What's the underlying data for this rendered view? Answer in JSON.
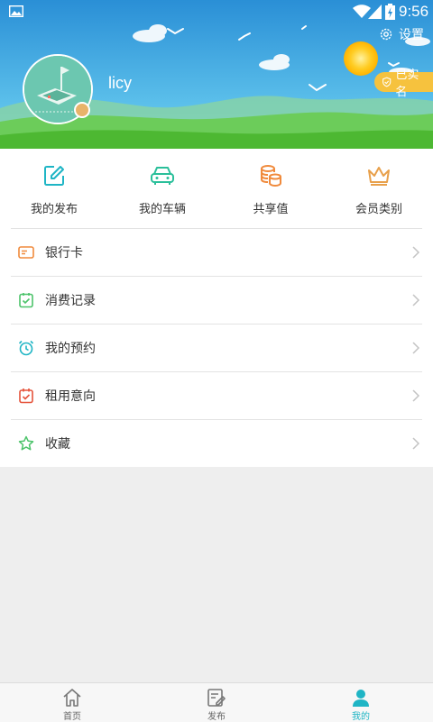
{
  "status_bar": {
    "time": "9:56"
  },
  "header": {
    "settings_label": "设置",
    "username": "licy",
    "verified_badge": "已实名"
  },
  "quick_actions": [
    {
      "label": "我的发布",
      "icon": "edit-icon",
      "color": "#1fb5c5"
    },
    {
      "label": "我的车辆",
      "icon": "car-icon",
      "color": "#2abf9a"
    },
    {
      "label": "共享值",
      "icon": "coins-icon",
      "color": "#f08a3c"
    },
    {
      "label": "会员类别",
      "icon": "crown-icon",
      "color": "#e8a04b"
    }
  ],
  "menu": [
    {
      "label": "银行卡",
      "icon": "bank-card-icon",
      "color": "#f08a3c"
    },
    {
      "label": "消费记录",
      "icon": "clipboard-check-icon",
      "color": "#4cc36a"
    },
    {
      "label": "我的预约",
      "icon": "alarm-clock-icon",
      "color": "#1fb5c5"
    },
    {
      "label": "租用意向",
      "icon": "calendar-check-icon",
      "color": "#e5533b"
    },
    {
      "label": "收藏",
      "icon": "star-icon",
      "color": "#4cc36a"
    }
  ],
  "tabbar": [
    {
      "label": "首页",
      "icon": "home-icon",
      "active": false
    },
    {
      "label": "发布",
      "icon": "publish-icon",
      "active": false
    },
    {
      "label": "我的",
      "icon": "person-icon",
      "active": true
    }
  ],
  "colors": {
    "accent": "#1fb5c5",
    "sky_top": "#2a8fd6",
    "grass": "#58c23d",
    "badge": "#f6c23e"
  }
}
